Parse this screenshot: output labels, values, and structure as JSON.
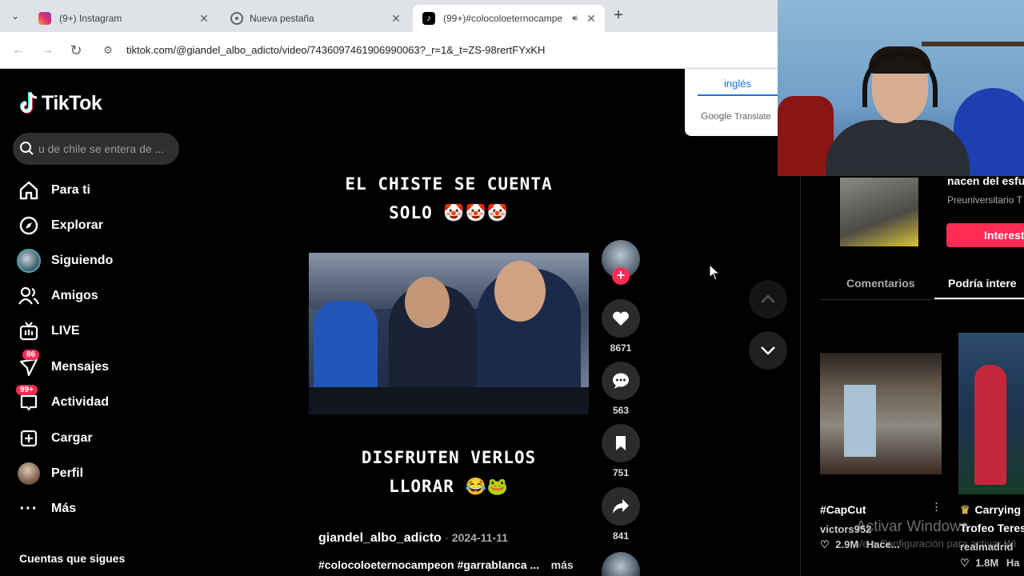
{
  "browser": {
    "tabs": [
      {
        "title": "(9+) Instagram",
        "active": false
      },
      {
        "title": "Nueva pestaña",
        "active": false
      },
      {
        "title": "(99+)#colocoloeternocampe",
        "active": true
      }
    ],
    "url": "tiktok.com/@giandel_albo_adicto/video/7436097461906990063?_r=1&_t=ZS-98rertFYxKH"
  },
  "translate": {
    "language": "inglés",
    "brand": "Google",
    "product": "Translate"
  },
  "sidebar": {
    "logo": "TikTok",
    "search_placeholder": "u de chile se entera de ...",
    "items": [
      {
        "label": "Para ti",
        "icon": "home-icon"
      },
      {
        "label": "Explorar",
        "icon": "compass-icon"
      },
      {
        "label": "Siguiendo",
        "icon": "following-avatar-icon"
      },
      {
        "label": "Amigos",
        "icon": "friends-icon"
      },
      {
        "label": "LIVE",
        "icon": "live-tv-icon"
      },
      {
        "label": "Mensajes",
        "icon": "messages-icon",
        "badge": "86"
      },
      {
        "label": "Actividad",
        "icon": "activity-icon",
        "badge": "99+"
      },
      {
        "label": "Cargar",
        "icon": "upload-icon"
      },
      {
        "label": "Perfil",
        "icon": "profile-avatar-icon"
      },
      {
        "label": "Más",
        "icon": "more-dots-icon"
      }
    ],
    "following_header": "Cuentas que sigues"
  },
  "video": {
    "caption_top_line1": "EL CHISTE SE CUENTA",
    "caption_top_line2": "SOLO 🤡🤡🤡",
    "caption_bottom_line1": "DISFRUTEN VERLOS",
    "caption_bottom_line2": "LLORAR 😂🐸",
    "author": "giandel_albo_adicto",
    "date": "2024-11-11",
    "hashtags": "#colocoloeternocampeon #garrablanca ...",
    "more": "más",
    "likes": "8671",
    "comments": "563",
    "saves": "751",
    "shares": "841"
  },
  "right_panel": {
    "ad_title": "nacen del esfu",
    "ad_sub": "Preuniversitario T",
    "ad_button": "Interest",
    "tabs": [
      "Comentarios",
      "Podría intere"
    ],
    "cards": [
      {
        "title": "#CapCut",
        "author": "victors952",
        "views": "2.9M",
        "extra": "Hace..."
      },
      {
        "title": "Carrying",
        "title2": "Trofeo Teres",
        "author": "realmadrid",
        "views": "1.8M",
        "extra": "Ha"
      }
    ],
    "watermark_1": "Activar Windows",
    "watermark_2": "Ve a Configuración para activar Wi"
  },
  "colors": {
    "accent": "#fe2c55",
    "bg": "#000000",
    "chrome": "#dfe3e8"
  }
}
